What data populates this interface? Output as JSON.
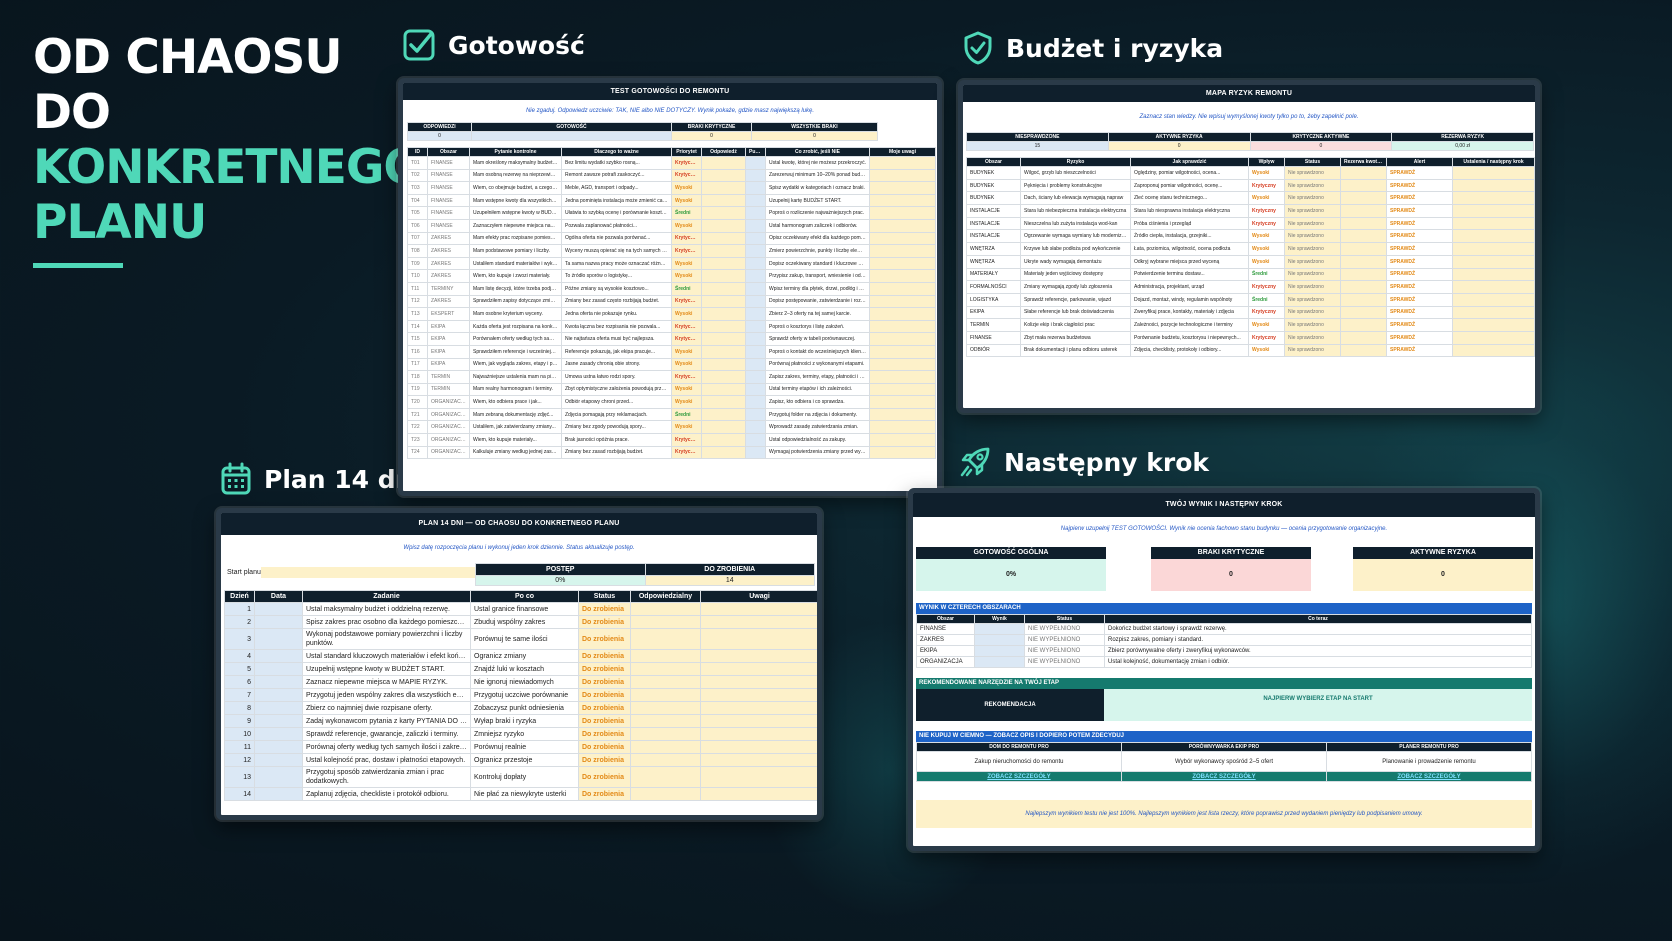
{
  "hero": {
    "line1": "OD CHAOSU",
    "line2": "DO",
    "line3": "KONKRETNEGO",
    "line4": "PLANU"
  },
  "colors": {
    "accent": "#4fd8b8",
    "background": "#0a1a24",
    "sheet_header": "#0f1f2c"
  },
  "sections": {
    "gotowosc": {
      "label": "Gotowość",
      "icon": "checkbox-icon"
    },
    "budzet": {
      "label": "Budżet i ryzyka",
      "icon": "shield-check-icon"
    },
    "plan": {
      "label": "Plan 14 dni",
      "icon": "calendar-icon"
    },
    "nastepny": {
      "label": "Następny krok",
      "icon": "rocket-icon"
    }
  },
  "gotowosc_sheet": {
    "title": "TEST GOTOWOŚCI DO REMONTU",
    "hint": "Nie zgaduj. Odpowiedz uczciwie: TAK, NIE albo NIE DOTYCZY. Wynik pokaże, gdzie masz największą lukę.",
    "summary_headers": [
      "ODPOWIEDZI",
      "GOTOWOŚĆ",
      "BRAKI KRYTYCZNE",
      "WSZYSTKIE BRAKI"
    ],
    "summary_values": [
      "0",
      "",
      "0",
      "0"
    ],
    "columns": [
      "ID",
      "Obszar",
      "Pytanie kontrolne",
      "Dlaczego to ważne",
      "Priorytet",
      "Odpowiedź",
      "Punkt",
      "Co zrobić, jeśli NIE",
      "Moje uwagi"
    ],
    "rows": [
      [
        "T01",
        "FINANSE",
        "Mam określony maksymalny budżet remontu.",
        "Bez limitu wydatki szybko rosną...",
        "Krytyczny",
        "Ustal kwotę, której nie możesz przekroczyć."
      ],
      [
        "T02",
        "FINANSE",
        "Mam osobną rezerwę na nieprzewidziane...",
        "Remont zawsze potrafi zaskoczyć...",
        "Krytyczny",
        "Zarezerwuj minimum 10–20% ponad budżet."
      ],
      [
        "T03",
        "FINANSE",
        "Wiem, co obejmuje budżet, a czego nie.",
        "Meble, AGD, transport i odpady...",
        "Wysoki",
        "Spisz wydatki w kategoriach i oznacz braki."
      ],
      [
        "T04",
        "FINANSE",
        "Mam wstępne kwoty dla wszystkich dużych grup prac.",
        "Jedna pominięta instalacja może zmienić cały wynik.",
        "Wysoki",
        "Uzupełnij kartę BUDŻET START."
      ],
      [
        "T05",
        "FINANSE",
        "Uzupełniłem wstępne kwoty w BUDŻECIE...",
        "Ułatwia to szybką ocenę i porównanie kosztów.",
        "Średni",
        "Poproś o rozliczenie najważniejszych prac."
      ],
      [
        "T06",
        "FINANSE",
        "Zaznaczyłem niepewne miejsca na...",
        "Pozwala zaplanować płatności...",
        "Wysoki",
        "Ustal harmonogram zaliczek i odbiorów."
      ],
      [
        "T07",
        "ZAKRES",
        "Mam efekty prac rozpisane pomieszczeniami.",
        "Ogólna oferta nie pozwala porównać...",
        "Krytyczny",
        "Opisz oczekiwany efekt dla każdego pomieszczenia."
      ],
      [
        "T08",
        "ZAKRES",
        "Mam podstawowe pomiary i liczby.",
        "Wyceny muszą opierać się na tych samych danych.",
        "Krytyczny",
        "Zmierz powierzchnie, punkty i liczbę elementów."
      ],
      [
        "T09",
        "ZAKRES",
        "Ustaliłem standard materiałów i wykonania.",
        "Ta sama nazwa pracy może oznaczać różny efekt.",
        "Wysoki",
        "Dopisz oczekiwany standard i kluczowe materiały."
      ],
      [
        "T10",
        "ZAKRES",
        "Wiem, kto kupuje i zwozi materiały.",
        "To źródło sporów o logistykę...",
        "Wysoki",
        "Przypisz zakup, transport, wniesienie i odpady."
      ],
      [
        "T11",
        "TERMINY",
        "Mam listę decyzji, które trzeba podjąć przed...",
        "Późne zmiany są wysokie kosztowo...",
        "Średni",
        "Wpisz terminy dla płytek, drzwi, podłóg i oświetlenia."
      ],
      [
        "T12",
        "ZAKRES",
        "Sprawdziłem zapisy dotyczące zmian...",
        "Zmiany bez zasad często rozbijają budżet.",
        "Krytyczny",
        "Dopisz postępowanie, zatwierdzanie i rozliczenie zmian."
      ],
      [
        "T13",
        "EKSPERT",
        "Mam osobne kryterium wyceny.",
        "Jedna oferta nie pokazuje rynku.",
        "Wysoki",
        "Zbierz 2–3 oferty na tej samej karcie."
      ],
      [
        "T14",
        "EKIPA",
        "Każda oferta jest rozpisana na konkretne pozycje.",
        "Kwota łączna bez rozpisania nie pozwala...",
        "Krytyczny",
        "Poproś o kosztorys i listę założeń."
      ],
      [
        "T15",
        "EKIPA",
        "Porównałem oferty według tych samych kryteriów.",
        "Nie najtańsza oferta musi być najlepsza.",
        "Krytyczny",
        "Sprawdź oferty w tabeli porównawczej."
      ],
      [
        "T16",
        "EKIPA",
        "Sprawdziłem referencje i wcześniejsze...",
        "Referencje pokazują, jak ekipa pracuje...",
        "Wysoki",
        "Poproś o kontakt do wcześniejszych klientów."
      ],
      [
        "T17",
        "EKIPA",
        "Wiem, jak wygląda zakres, etapy i płatności.",
        "Jasne zasady chronią obie strony.",
        "Wysoki",
        "Porównaj płatności z wykonanymi etapami."
      ],
      [
        "T18",
        "TERMIN",
        "Najważniejsze ustalenia mam na piśmie.",
        "Umowa ustna łatwo rodzi spory.",
        "Krytyczny",
        "Zapisz zakres, terminy, etapy, płatności i odbiór."
      ],
      [
        "T19",
        "TERMIN",
        "Mam realny harmonogram i terminy.",
        "Zbyt optymistyczne założenia powodują przestoje.",
        "Wysoki",
        "Ustal terminy etapów i ich zależności."
      ],
      [
        "T20",
        "ORGANIZACJA",
        "Wiem, kto odbiera prace i jak...",
        "Odbiór etapowy chroni przed...",
        "Wysoki",
        "Zapisz, kto odbiera i co sprawdza."
      ],
      [
        "T21",
        "ORGANIZACJA",
        "Mam zebraną dokumentację zdjęć...",
        "Zdjęcia pomagają przy reklamacjach.",
        "Średni",
        "Przygotuj folder na zdjęcia i dokumenty."
      ],
      [
        "T22",
        "ORGANIZACJA",
        "Ustaliłem, jak zatwierdzamy zmiany...",
        "Zmiany bez zgody powodują spory...",
        "Wysoki",
        "Wprowadź zasadę zatwierdzania zmian."
      ],
      [
        "T23",
        "ORGANIZACJA",
        "Wiem, kto kupuje materiały...",
        "Brak jasności opóźnia prace.",
        "Krytyczny",
        "Ustal odpowiedzialność za zakupy."
      ],
      [
        "T24",
        "ORGANIZACJA",
        "Kalkuluje zmiany według jednej zasady.",
        "Zmiany bez zasad rozbijają budżet.",
        "Krytyczny",
        "Wymagaj potwierdzenia zmiany przed wykonaniem."
      ]
    ]
  },
  "budzet_sheet": {
    "title": "MAPA RYZYK REMONTU",
    "hint": "Zaznacz stan wiedzy. Nie wpisuj wymyślonej kwoty tylko po to, żeby zapełnić pole.",
    "summary_headers": [
      "NIESPRAWDZONE",
      "AKTYWNE RYZYKA",
      "KRYTYCZNE AKTYWNE",
      "REZERWA RYZYK"
    ],
    "summary_values": [
      "15",
      "0",
      "0",
      "0,00 zł"
    ],
    "columns": [
      "Obszar",
      "Ryzyko",
      "Jak sprawdzić",
      "Wpływ",
      "Status",
      "Rezerwa kwotowa",
      "Alert",
      "Ustalenia / następny krok"
    ],
    "rows": [
      [
        "BUDYNEK",
        "Wilgoć, grzyb lub nieszczelności",
        "Oględziny, pomiar wilgotności, ocena...",
        "Wysoki",
        "Nie sprawdzono",
        "SPRAWDŹ"
      ],
      [
        "BUDYNEK",
        "Pęknięcia i problemy konstrukcyjne",
        "Zaproponuj pomiar wilgotności, ocenę...",
        "Krytyczny",
        "Nie sprawdzono",
        "SPRAWDŹ"
      ],
      [
        "BUDYNEK",
        "Dach, ściany lub elewacja wymagają napraw",
        "Zleć ocenę stanu technicznego...",
        "Wysoki",
        "Nie sprawdzono",
        "SPRAWDŹ"
      ],
      [
        "INSTALACJE",
        "Stara lub niebezpieczna instalacja elektryczna",
        "Stara lub niesprawna instalacja elektryczna",
        "Krytyczny",
        "Nie sprawdzono",
        "SPRAWDŹ"
      ],
      [
        "INSTALACJE",
        "Nieszczelna lub zużyta instalacja wod-kan",
        "Próba ciśnienia i przegląd",
        "Krytyczny",
        "Nie sprawdzono",
        "SPRAWDŹ"
      ],
      [
        "INSTALACJE",
        "Ogrzewanie wymaga wymiany lub modernizacji",
        "Źródło ciepła, instalacja, grzejniki...",
        "Wysoki",
        "Nie sprawdzono",
        "SPRAWDŹ"
      ],
      [
        "WNĘTRZA",
        "Krzywe lub słabe podłoża pod wykończenie",
        "Łata, poziomica, wilgotność, ocena podłoża",
        "Wysoki",
        "Nie sprawdzono",
        "SPRAWDŹ"
      ],
      [
        "WNĘTRZA",
        "Ukryte wady wymagają demontażu",
        "Odkryj wybrane miejsca przed wyceną",
        "Wysoki",
        "Nie sprawdzono",
        "SPRAWDŹ"
      ],
      [
        "MATERIAŁY",
        "Materiały jeden wyjściowy dostępny",
        "Potwierdzenie terminu dostaw...",
        "Średni",
        "Nie sprawdzono",
        "SPRAWDŹ"
      ],
      [
        "FORMALNOŚCI",
        "Zmiany wymagają zgody lub zgłoszenia",
        "Administracja, projektant, urząd",
        "Krytyczny",
        "Nie sprawdzono",
        "SPRAWDŹ"
      ],
      [
        "LOGISTYKA",
        "Sprawdź referencje, parkowanie, wjazd",
        "Dojazd, montaż, windy, regulamin wspólnoty",
        "Średni",
        "Nie sprawdzono",
        "SPRAWDŹ"
      ],
      [
        "EKIPA",
        "Słabe referencje lub brak doświadczenia",
        "Zweryfikuj prace, kontakty, materiały i zdjęcia",
        "Krytyczny",
        "Nie sprawdzono",
        "SPRAWDŹ"
      ],
      [
        "TERMIN",
        "Kolizje ekip i brak ciągłości prac",
        "Zależności, pozycje technologiczne i terminy",
        "Wysoki",
        "Nie sprawdzono",
        "SPRAWDŹ"
      ],
      [
        "FINANSE",
        "Zbyt mała rezerwa budżetowa",
        "Porównanie budżetu, kosztorysu i niepewnych...",
        "Krytyczny",
        "Nie sprawdzono",
        "SPRAWDŹ"
      ],
      [
        "ODBIÓR",
        "Brak dokumentacji i planu odbioru usterek",
        "Zdjęcia, checklisty, protokoły i odbiory...",
        "Wysoki",
        "Nie sprawdzono",
        "SPRAWDŹ"
      ]
    ]
  },
  "plan_sheet": {
    "title": "PLAN 14 DNI — OD CHAOSU DO KONKRETNEGO PLANU",
    "hint": "Wpisz datę rozpoczęcia planu i wykonuj jeden krok dziennie. Status aktualizuje postęp.",
    "start_label": "Start planu",
    "start_value": "",
    "progress_headers": [
      "POSTĘP",
      "DO ZROBIENIA"
    ],
    "progress_values": [
      "0%",
      "14"
    ],
    "columns": [
      "Dzień",
      "Data",
      "Zadanie",
      "Po co",
      "Status",
      "Odpowiedzialny",
      "Uwagi"
    ],
    "rows": [
      [
        "1",
        "",
        "Ustal maksymalny budżet i oddzielną rezerwę.",
        "Ustal granice finansowe",
        "Do zrobienia"
      ],
      [
        "2",
        "",
        "Spisz zakres prac osobno dla każdego pomieszczenia.",
        "Zbuduj wspólny zakres",
        "Do zrobienia"
      ],
      [
        "3",
        "",
        "Wykonaj podstawowe pomiary powierzchni i liczby punktów.",
        "Porównuj te same ilości",
        "Do zrobienia"
      ],
      [
        "4",
        "",
        "Ustal standard kluczowych materiałów i efekt końcowy.",
        "Ogranicz zmiany",
        "Do zrobienia"
      ],
      [
        "5",
        "",
        "Uzupełnij wstępne kwoty w BUDŻET START.",
        "Znajdź luki w kosztach",
        "Do zrobienia"
      ],
      [
        "6",
        "",
        "Zaznacz niepewne miejsca w MAPIE RYZYK.",
        "Nie ignoruj niewiadomych",
        "Do zrobienia"
      ],
      [
        "7",
        "",
        "Przygotuj jeden wspólny zakres dla wszystkich ekip.",
        "Przygotuj uczciwe porównanie",
        "Do zrobienia"
      ],
      [
        "8",
        "",
        "Zbierz co najmniej dwie rozpisane oferty.",
        "Zobaczysz punkt odniesienia",
        "Do zrobienia"
      ],
      [
        "9",
        "",
        "Zadaj wykonawcom pytania z karty PYTANIA DO EKIP.",
        "Wyłap braki i ryzyka",
        "Do zrobienia"
      ],
      [
        "10",
        "",
        "Sprawdź referencje, gwarancje, zaliczki i terminy.",
        "Zmniejsz ryzyko",
        "Do zrobienia"
      ],
      [
        "11",
        "",
        "Porównaj oferty według tych samych ilości i zakresu.",
        "Porównuj realnie",
        "Do zrobienia"
      ],
      [
        "12",
        "",
        "Ustal kolejność prac, dostaw i płatności etapowych.",
        "Ogranicz przestoje",
        "Do zrobienia"
      ],
      [
        "13",
        "",
        "Przygotuj sposób zatwierdzania zmian i prac dodatkowych.",
        "Kontroluj dopłaty",
        "Do zrobienia"
      ],
      [
        "14",
        "",
        "Zaplanuj zdjęcia, checkliste i protokół odbioru.",
        "Nie płać za niewykryte usterki",
        "Do zrobienia"
      ]
    ]
  },
  "next_sheet": {
    "title": "TWÓJ WYNIK I NASTĘPNY KROK",
    "hint": "Najpierw uzupełnij TEST GOTOWOŚCI. Wynik nie ocenia fachowo stanu budynku — ocenia przygotowanie organizacyjne.",
    "kpis": [
      {
        "label": "GOTOWOŚĆ OGÓLNA",
        "value": "0%",
        "color": "#d6f5ec"
      },
      {
        "label": "BRAKI KRYTYCZNE",
        "value": "0",
        "color": "#fbd7d7"
      },
      {
        "label": "AKTYWNE RYZYKA",
        "value": "0",
        "color": "#fdf1c9"
      }
    ],
    "areas_title": "WYNIK W CZTERECH OBSZARACH",
    "areas_columns": [
      "Obszar",
      "Wynik",
      "Status",
      "Co teraz"
    ],
    "areas": [
      [
        "FINANSE",
        "",
        "NIE WYPEŁNIONO",
        "Dokończ budżet startowy i sprawdź rezerwę."
      ],
      [
        "ZAKRES",
        "",
        "NIE WYPEŁNIONO",
        "Rozpisz zakres, pomiary i standard."
      ],
      [
        "EKIPA",
        "",
        "NIE WYPEŁNIONO",
        "Zbierz porównywalne oferty i zweryfikuj wykonawców."
      ],
      [
        "ORGANIZACJA",
        "",
        "NIE WYPEŁNIONO",
        "Ustal kolejność, dokumentację zmian i odbiór."
      ]
    ],
    "tool_title": "REKOMENDOWANE NARZĘDZIE NA TWÓJ ETAP",
    "tool_label": "REKOMENDACJA",
    "tool_value": "NAJPIERW WYBIERZ ETAP NA START",
    "buy_title": "NIE KUPUJ W CIEMNO — ZOBACZ OPIS I DOPIERO POTEM ZDECYDUJ",
    "products": [
      {
        "name": "DOM DO REMONTU PRO",
        "desc": "Zakup nieruchomości do remontu",
        "link": "ZOBACZ SZCZEGÓŁY"
      },
      {
        "name": "PORÓWNYWARKA EKIP PRO",
        "desc": "Wybór wykonawcy spośród 2–5 ofert",
        "link": "ZOBACZ SZCZEGÓŁY"
      },
      {
        "name": "PLANER REMONTU PRO",
        "desc": "Planowanie i prowadzenie remontu",
        "link": "ZOBACZ SZCZEGÓŁY"
      }
    ],
    "footer": "Najlepszym wynikiem testu nie jest 100%. Najlepszym wynikiem jest lista rzeczy, które poprawisz przed wydaniem pieniędzy lub podpisaniem umowy."
  }
}
